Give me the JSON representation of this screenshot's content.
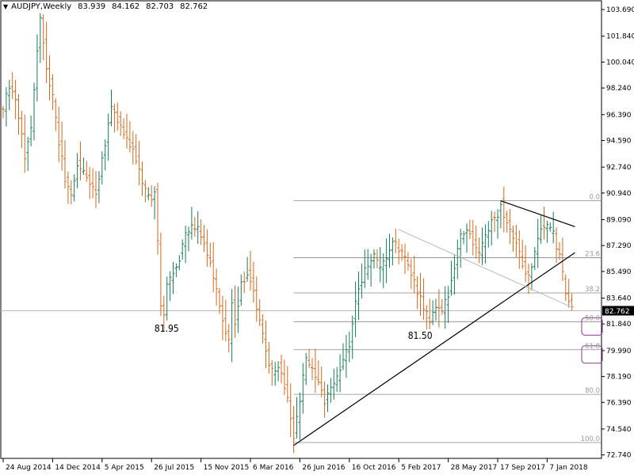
{
  "header": {
    "menu_arrow": "▼",
    "symbol_tf": "AUDJPY,Weekly",
    "open": "83.939",
    "high": "84.162",
    "low": "82.703",
    "close": "82.762"
  },
  "colors": {
    "up": "#1b7a5b",
    "down": "#d2691e",
    "price_line": "#bbbbbb",
    "price_tag_bg": "#000000",
    "price_tag_text": "#ffffff",
    "fib_line": "#888888",
    "fib_label": "#999999",
    "circled_label": "#8b3a8b",
    "trend_main": "#000000",
    "trend_faint": "#bbbbbb"
  },
  "chart_data": {
    "type": "candlestick",
    "title": "AUDJPY,Weekly",
    "ylim": [
      72.5,
      104.3
    ],
    "x_ticks": [
      {
        "label": "24 Aug 2014",
        "index": 0
      },
      {
        "label": "14 Dec 2014",
        "index": 16
      },
      {
        "label": "5 Apr 2015",
        "index": 32
      },
      {
        "label": "26 Jul 2015",
        "index": 48
      },
      {
        "label": "15 Nov 2015",
        "index": 64
      },
      {
        "label": "6 Mar 2016",
        "index": 80
      },
      {
        "label": "26 Jun 2016",
        "index": 96
      },
      {
        "label": "16 Oct 2016",
        "index": 112
      },
      {
        "label": "5 Feb 2017",
        "index": 128
      },
      {
        "label": "28 May 2017",
        "index": 144
      },
      {
        "label": "17 Sep 2017",
        "index": 160
      },
      {
        "label": "7 Jan 2018",
        "index": 176
      }
    ],
    "y_ticks": [
      "103.690",
      "101.840",
      "100.040",
      "98.240",
      "96.390",
      "94.590",
      "92.740",
      "90.940",
      "89.090",
      "87.290",
      "85.490",
      "83.640",
      "81.840",
      "79.990",
      "78.190",
      "76.390",
      "74.540",
      "72.740"
    ],
    "current_price": "82.762",
    "anchors": [
      [
        0,
        96.8
      ],
      [
        1,
        98.0
      ],
      [
        2,
        98.5
      ],
      [
        4,
        97.5
      ],
      [
        6,
        95.0
      ],
      [
        7,
        93.5
      ],
      [
        9,
        95.5
      ],
      [
        11,
        101.0
      ],
      [
        12,
        103.0
      ],
      [
        13,
        101.5
      ],
      [
        14,
        99.8
      ],
      [
        16,
        97.5
      ],
      [
        18,
        94.5
      ],
      [
        20,
        92.0
      ],
      [
        22,
        90.6
      ],
      [
        24,
        93.0
      ],
      [
        27,
        92.0
      ],
      [
        30,
        91.0
      ],
      [
        33,
        94.5
      ],
      [
        35,
        97.0
      ],
      [
        37,
        96.0
      ],
      [
        40,
        94.5
      ],
      [
        42,
        94.0
      ],
      [
        44,
        92.5
      ],
      [
        46,
        91.0
      ],
      [
        48,
        90.5
      ],
      [
        49,
        91.0
      ],
      [
        50,
        87.5
      ],
      [
        51,
        83.0
      ],
      [
        52,
        82.3
      ],
      [
        53,
        84.5
      ],
      [
        55,
        85.5
      ],
      [
        57,
        86.5
      ],
      [
        59,
        88.0
      ],
      [
        61,
        88.5
      ],
      [
        63,
        88.5
      ],
      [
        65,
        87.5
      ],
      [
        67,
        86.0
      ],
      [
        69,
        84.0
      ],
      [
        71,
        82.0
      ],
      [
        73,
        80.5
      ],
      [
        74,
        83.5
      ],
      [
        75,
        82.0
      ],
      [
        77,
        84.5
      ],
      [
        79,
        85.5
      ],
      [
        81,
        84.0
      ],
      [
        83,
        82.0
      ],
      [
        85,
        80.0
      ],
      [
        87,
        78.5
      ],
      [
        89,
        79.0
      ],
      [
        91,
        77.5
      ],
      [
        93,
        75.5
      ],
      [
        94,
        74.0
      ],
      [
        96,
        76.5
      ],
      [
        98,
        79.5
      ],
      [
        100,
        78.5
      ],
      [
        102,
        77.5
      ],
      [
        104,
        76.5
      ],
      [
        106,
        77.5
      ],
      [
        108,
        78.0
      ],
      [
        110,
        79.5
      ],
      [
        112,
        80.5
      ],
      [
        114,
        83.5
      ],
      [
        116,
        85.0
      ],
      [
        118,
        86.0
      ],
      [
        120,
        86.5
      ],
      [
        122,
        85.5
      ],
      [
        124,
        86.5
      ],
      [
        126,
        87.5
      ],
      [
        128,
        87.0
      ],
      [
        130,
        86.5
      ],
      [
        132,
        85.5
      ],
      [
        134,
        84.0
      ],
      [
        136,
        83.0
      ],
      [
        138,
        82.0
      ],
      [
        140,
        83.0
      ],
      [
        142,
        82.5
      ],
      [
        144,
        84.0
      ],
      [
        146,
        86.0
      ],
      [
        148,
        88.0
      ],
      [
        150,
        88.5
      ],
      [
        152,
        87.5
      ],
      [
        154,
        86.5
      ],
      [
        156,
        88.0
      ],
      [
        158,
        89.0
      ],
      [
        160,
        89.5
      ],
      [
        161,
        90.3
      ],
      [
        162,
        89.5
      ],
      [
        164,
        88.5
      ],
      [
        166,
        87.5
      ],
      [
        168,
        86.0
      ],
      [
        170,
        85.0
      ],
      [
        172,
        87.0
      ],
      [
        174,
        88.5
      ],
      [
        176,
        88.8
      ],
      [
        178,
        88.0
      ],
      [
        180,
        86.5
      ],
      [
        181,
        85.2
      ],
      [
        182,
        84.0
      ],
      [
        183,
        83.5
      ],
      [
        184,
        82.8
      ]
    ],
    "fib_levels": [
      {
        "label": "0.0",
        "price": 90.4
      },
      {
        "label": "23.6",
        "price": 86.45
      },
      {
        "label": "38.2",
        "price": 84.0
      },
      {
        "label": "50.0",
        "price": 82.0
      },
      {
        "label": "61.8",
        "price": 80.05
      },
      {
        "label": "80.0",
        "price": 76.95
      },
      {
        "label": "100.0",
        "price": 73.6
      }
    ],
    "circled_levels": [
      "50.0",
      "61.8"
    ],
    "annotations": [
      {
        "text": "81.95",
        "index": 51,
        "price": 81.3
      },
      {
        "text": "81.50",
        "index": 133,
        "price": 80.8
      }
    ],
    "trendlines": [
      {
        "from": [
          94,
          73.4
        ],
        "to": [
          185,
          86.8
        ],
        "style": "main"
      },
      {
        "from": [
          161,
          90.4
        ],
        "to": [
          185,
          88.6
        ],
        "style": "main"
      },
      {
        "from": [
          128,
          88.4
        ],
        "to": [
          184,
          83.0
        ],
        "style": "faint"
      }
    ]
  }
}
